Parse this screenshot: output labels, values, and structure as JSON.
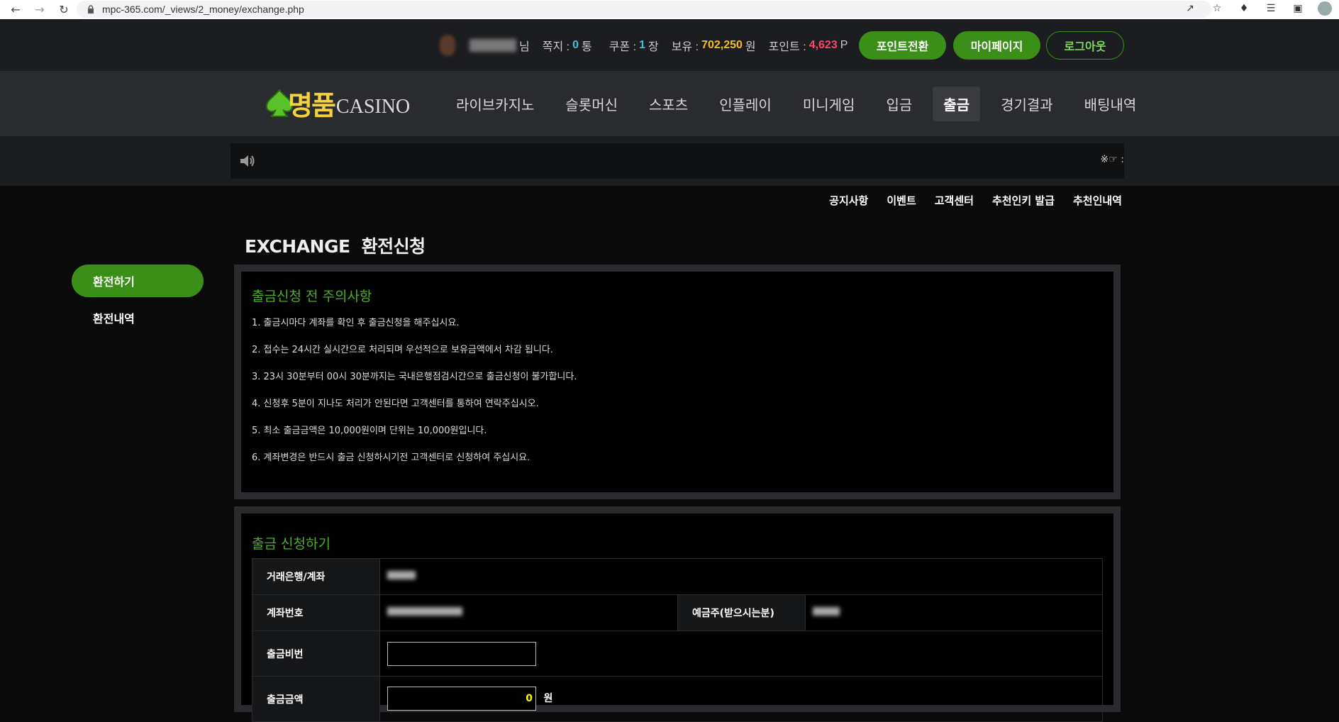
{
  "browser": {
    "url": "mpc-365.com/_views/2_money/exchange.php"
  },
  "userbar": {
    "suffix_nim": "님",
    "message_label": "쪽지 :",
    "message_count": "0",
    "message_unit": "통",
    "coupon_label": "쿠폰 :",
    "coupon_count": "1",
    "coupon_unit": "장",
    "balance_label": "보유 :",
    "balance_value": "702,250",
    "balance_unit": "원",
    "point_label": "포인트 :",
    "point_value": "4,623",
    "point_unit": "P",
    "btn_point_convert": "포인트전환",
    "btn_mypage": "마이페이지",
    "btn_logout": "로그아웃"
  },
  "logo": {
    "kor": "명품",
    "eng": "CASINO"
  },
  "menu": [
    "라이브카지노",
    "슬롯머신",
    "스포츠",
    "인플레이",
    "미니게임",
    "입금",
    "출금",
    "경기결과",
    "배팅내역"
  ],
  "menu_active": "출금",
  "notice": {
    "marquee": "※☞ :"
  },
  "sublinks": [
    "공지사항",
    "이벤트",
    "고객센터",
    "추천인키 발급",
    "추천인내역"
  ],
  "sidemenu": [
    "환전하기",
    "환전내역"
  ],
  "title": {
    "en": "EXCHANGE",
    "ko": "환전신청"
  },
  "notice_panel": {
    "heading": "출금신청 전 주의사항",
    "rules": [
      "1. 출금시마다 계좌를 확인 후 출금신청을 해주십시요.",
      "2. 접수는 24시간 실시간으로 처리되며 우선적으로 보유금액에서 차감 됩니다.",
      "3. 23시 30분부터 00시 30분까지는 국내은행점검시간으로 출금신청이 불가합니다.",
      "4. 신청후 5분이 지나도 처리가 안된다면 고객센터를 통하여 연락주십시오.",
      "5. 최소 출금금액은 10,000원이며 단위는 10,000원입니다.",
      "6. 계좌변경은 반드시 출금 신청하시기전 고객센터로 신청하여 주십시요."
    ]
  },
  "form_panel": {
    "heading": "출금 신청하기",
    "bank_label": "거래은행/계좌",
    "account_label": "계좌번호",
    "holder_label": "예금주(받으시는분)",
    "password_label": "출금비번",
    "amount_label": "출금금액",
    "amount_value": "0",
    "amount_unit": "원"
  }
}
